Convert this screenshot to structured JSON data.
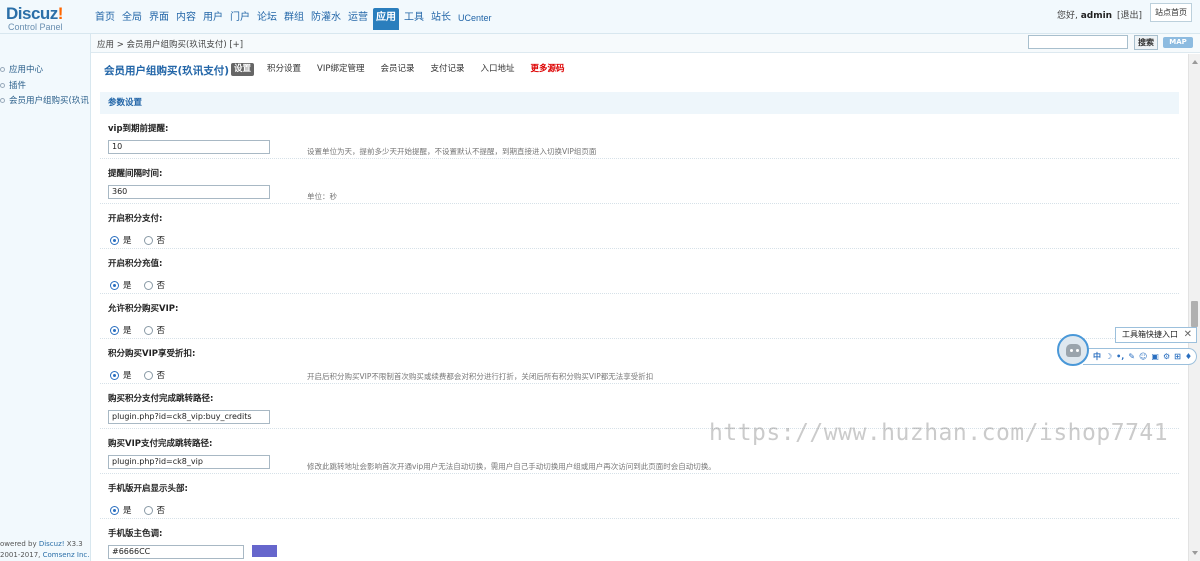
{
  "header": {
    "logo_main": "Discuz",
    "logo_bang": "!",
    "logo_sub": "Control Panel",
    "nav": [
      "首页",
      "全局",
      "界面",
      "内容",
      "用户",
      "门户",
      "论坛",
      "群组",
      "防灌水",
      "运营",
      "应用",
      "工具",
      "站长",
      "UCenter"
    ],
    "active_nav": "应用",
    "greeting": "您好,",
    "username": "admin",
    "logout": "[退出]",
    "home_button": "站点首页"
  },
  "subbar": {
    "breadcrumb": "应用 > 会员用户组购买(玖讯支付) [+]",
    "search_value": "",
    "search_button": "搜索",
    "map_button": "MAP"
  },
  "sidebar": {
    "items": [
      "应用中心",
      "插件",
      "会员用户组购买(玖讯支"
    ],
    "footer_line1_prefix": "owered by ",
    "footer_line1_link": "Discuz!",
    "footer_line1_suffix": " X3.3",
    "footer_line2_prefix": "2001-2017, ",
    "footer_line2_link": "Comsenz Inc."
  },
  "page": {
    "title": "会员用户组购买(玖讯支付)",
    "tabs": [
      "设置",
      "积分设置",
      "VIP绑定管理",
      "会员记录",
      "支付记录",
      "入口地址",
      "更多源码"
    ],
    "active_tab": "设置",
    "section_title": "参数设置"
  },
  "settings": [
    {
      "label": "vip到期前提醒:",
      "value": "10",
      "hint": "设置单位为天，提前多少天开始提醒，不设置默认不提醒，到期直接进入切换VIP组页面"
    },
    {
      "label": "提醒间隔时间:",
      "value": "360",
      "hint": "单位：秒"
    },
    {
      "label": "开启积分支付:",
      "yes": "是",
      "no": "否",
      "selected": "是"
    },
    {
      "label": "开启积分充值:",
      "yes": "是",
      "no": "否",
      "selected": "是"
    },
    {
      "label": "允许积分购买VIP:",
      "yes": "是",
      "no": "否",
      "selected": "是"
    },
    {
      "label": "积分购买VIP享受折扣:",
      "yes": "是",
      "no": "否",
      "selected": "是",
      "hint": "开启后积分购买VIP不限制首次购买或续费都会对积分进行打折，关闭后所有积分购买VIP都无法享受折扣"
    },
    {
      "label": "购买积分支付完成跳转路径:",
      "value": "plugin.php?id=ck8_vip:buy_credits"
    },
    {
      "label": "购买VIP支付完成跳转路径:",
      "value": "plugin.php?id=ck8_vip",
      "hint": "修改此跳转地址会影响首次开通vip用户无法自动切换，需用户自己手动切换用户组或用户再次访问到此页面时会自动切换。"
    },
    {
      "label": "手机版开启显示头部:",
      "yes": "是",
      "no": "否",
      "selected": "是"
    },
    {
      "label": "手机版主色调:",
      "value": "#6666CC",
      "color": "#6666CC"
    }
  ],
  "ime": {
    "tip": "工具箱快捷入口",
    "close": "✕",
    "icons": [
      "中",
      "☽",
      "•,",
      "✎",
      "☺",
      "▣",
      "⚙",
      "⊞",
      "♦"
    ]
  },
  "watermark": "https://www.huzhan.com/ishop7741"
}
